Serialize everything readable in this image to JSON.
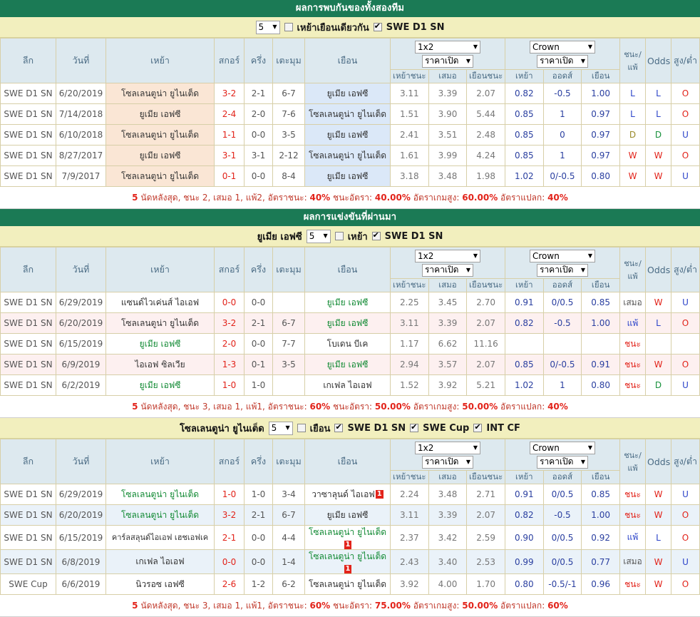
{
  "columns": {
    "league": "ลีก",
    "date": "วันที่",
    "home": "เหย้า",
    "score": "สกอร์",
    "half": "ครึ่ง",
    "corner": "เตะมุม",
    "away": "เยือน",
    "home_win": "เหย้าชนะ",
    "draw": "เสมอ",
    "away_win": "เยือนชนะ",
    "ah_home": "เหย้า",
    "ah_line": "ออดส์",
    "ah_away": "เยือน",
    "wl": "ชนะ/แพ้",
    "odds": "Odds",
    "ou": "สูง/ต่ำ",
    "odds_group_select": "1x2",
    "odds_group_sub": "ราคาเปิด",
    "ah_group_select": "Crown",
    "ah_group_sub": "ราคาเปิด"
  },
  "sections": [
    {
      "id": "h2h",
      "banner": "ผลการพบกันของทั้งสองทีม",
      "filter": {
        "team_label": "",
        "count": "5",
        "checkboxes": [
          {
            "label": "เหย้าเยือนเดียวกัน",
            "checked": false
          },
          {
            "label": "SWE D1 SN",
            "checked": true
          }
        ]
      },
      "rows": [
        {
          "league": "SWE D1 SN",
          "date": "6/20/2019",
          "home": "โซลเลนตูน่า ยูไนเต็ด",
          "home_hl": false,
          "home_badge": "",
          "score": "3-2",
          "half": "2-1",
          "corner": "6-7",
          "away": "ยูเมีย เอฟซี",
          "away_hl": true,
          "away_badge": "",
          "hw": "3.11",
          "d": "3.39",
          "aw": "2.07",
          "ahh": "0.82",
          "ahl": "-0.5",
          "aha": "1.00",
          "wl": "L",
          "wl_color": "blue",
          "odds": "L",
          "odds_color": "blue",
          "ou": "O",
          "ou_color": "red"
        },
        {
          "league": "SWE D1 SN",
          "date": "7/14/2018",
          "home": "ยูเมีย เอฟซี",
          "home_hl": true,
          "home_badge": "",
          "score": "2-4",
          "half": "2-0",
          "corner": "7-6",
          "away": "โซลเลนตูน่า ยูไนเต็ด",
          "away_hl": false,
          "away_badge": "",
          "hw": "1.51",
          "d": "3.90",
          "aw": "5.44",
          "ahh": "0.85",
          "ahl": "1",
          "aha": "0.97",
          "wl": "L",
          "wl_color": "blue",
          "odds": "L",
          "odds_color": "blue",
          "ou": "O",
          "ou_color": "red"
        },
        {
          "league": "SWE D1 SN",
          "date": "6/10/2018",
          "home": "โซลเลนตูน่า ยูไนเต็ด",
          "home_hl": false,
          "home_badge": "",
          "score": "1-1",
          "half": "0-0",
          "corner": "3-5",
          "away": "ยูเมีย เอฟซี",
          "away_hl": true,
          "away_badge": "",
          "hw": "2.41",
          "d": "3.51",
          "aw": "2.48",
          "ahh": "0.85",
          "ahl": "0",
          "aha": "0.97",
          "wl": "D",
          "wl_color": "olive",
          "odds": "D",
          "odds_color": "green",
          "ou": "U",
          "ou_color": "blue"
        },
        {
          "league": "SWE D1 SN",
          "date": "8/27/2017",
          "home": "ยูเมีย เอฟซี",
          "home_hl": true,
          "home_badge": "",
          "score": "3-1",
          "half": "3-1",
          "corner": "2-12",
          "away": "โซลเลนตูน่า ยูไนเต็ด",
          "away_hl": false,
          "away_badge": "",
          "hw": "1.61",
          "d": "3.99",
          "aw": "4.24",
          "ahh": "0.85",
          "ahl": "1",
          "aha": "0.97",
          "wl": "W",
          "wl_color": "red",
          "odds": "W",
          "odds_color": "red",
          "ou": "O",
          "ou_color": "red"
        },
        {
          "league": "SWE D1 SN",
          "date": "7/9/2017",
          "home": "โซลเลนตูน่า ยูไนเต็ด",
          "home_hl": false,
          "home_badge": "",
          "score": "0-1",
          "half": "0-0",
          "corner": "8-4",
          "away": "ยูเมีย เอฟซี",
          "away_hl": true,
          "away_badge": "",
          "hw": "3.18",
          "d": "3.48",
          "aw": "1.98",
          "ahh": "1.02",
          "ahl": "0/-0.5",
          "aha": "0.80",
          "wl": "W",
          "wl_color": "red",
          "odds": "W",
          "odds_color": "red",
          "ou": "U",
          "ou_color": "blue"
        }
      ],
      "summary": {
        "count": "5",
        "text_a": "นัดหลังสุด, ชนะ 2, เสมอ 1, แพ้2, อัตราชนะ:",
        "v1": "40%",
        "text_b": "ชนะอัตรา:",
        "v2": "40.00%",
        "text_c": "อัตราเกมสูง:",
        "v3": "60.00%",
        "text_d": "อัตราแปลก:",
        "v4": "40%"
      }
    },
    {
      "id": "away-form",
      "banner": "ผลการแข่งขันที่ผ่านมา",
      "filter": {
        "team_label": "ยูเมีย เอฟซี",
        "count": "5",
        "checkboxes": [
          {
            "label": "เหย้า",
            "checked": false
          },
          {
            "label": "SWE D1 SN",
            "checked": true
          }
        ]
      },
      "rows": [
        {
          "league": "SWE D1 SN",
          "date": "6/29/2019",
          "home": "แซนด์ไวเค่นส์ ไอเอฟ",
          "home_hl": false,
          "home_badge": "",
          "score": "0-0",
          "half": "0-0",
          "corner": "",
          "away": "ยูเมีย เอฟซี",
          "away_hl": true,
          "away_badge": "",
          "hw": "2.25",
          "d": "3.45",
          "aw": "2.70",
          "ahh": "0.91",
          "ahl": "0/0.5",
          "aha": "0.85",
          "wl": "เสมอ",
          "wl_color": "dark",
          "odds": "W",
          "odds_color": "red",
          "ou": "U",
          "ou_color": "blue"
        },
        {
          "league": "SWE D1 SN",
          "date": "6/20/2019",
          "home": "โซลเลนตูน่า ยูไนเต็ด",
          "home_hl": false,
          "home_badge": "",
          "score": "3-2",
          "half": "2-1",
          "corner": "6-7",
          "away": "ยูเมีย เอฟซี",
          "away_hl": true,
          "away_badge": "",
          "hw": "3.11",
          "d": "3.39",
          "aw": "2.07",
          "ahh": "0.82",
          "ahl": "-0.5",
          "aha": "1.00",
          "wl": "แพ้",
          "wl_color": "blue",
          "odds": "L",
          "odds_color": "blue",
          "ou": "O",
          "ou_color": "red"
        },
        {
          "league": "SWE D1 SN",
          "date": "6/15/2019",
          "home": "ยูเมีย เอฟซี",
          "home_hl": true,
          "home_badge": "",
          "score": "2-0",
          "half": "0-0",
          "corner": "7-7",
          "away": "โบเดน บีเค",
          "away_hl": false,
          "away_badge": "",
          "hw": "1.17",
          "d": "6.62",
          "aw": "11.16",
          "ahh": "",
          "ahl": "",
          "aha": "",
          "wl": "ชนะ",
          "wl_color": "red",
          "odds": "",
          "odds_color": "dark",
          "ou": "",
          "ou_color": "dark"
        },
        {
          "league": "SWE D1 SN",
          "date": "6/9/2019",
          "home": "ไอเอฟ ซิลเวีย",
          "home_hl": false,
          "home_badge": "",
          "score": "1-3",
          "half": "0-1",
          "corner": "3-5",
          "away": "ยูเมีย เอฟซี",
          "away_hl": true,
          "away_badge": "",
          "hw": "2.94",
          "d": "3.57",
          "aw": "2.07",
          "ahh": "0.85",
          "ahl": "0/-0.5",
          "aha": "0.91",
          "wl": "ชนะ",
          "wl_color": "red",
          "odds": "W",
          "odds_color": "red",
          "ou": "O",
          "ou_color": "red"
        },
        {
          "league": "SWE D1 SN",
          "date": "6/2/2019",
          "home": "ยูเมีย เอฟซี",
          "home_hl": true,
          "home_badge": "",
          "score": "1-0",
          "half": "1-0",
          "corner": "",
          "away": "เกเฟล ไอเอฟ",
          "away_hl": false,
          "away_badge": "",
          "hw": "1.52",
          "d": "3.92",
          "aw": "5.21",
          "ahh": "1.02",
          "ahl": "1",
          "aha": "0.80",
          "wl": "ชนะ",
          "wl_color": "red",
          "odds": "D",
          "odds_color": "green",
          "ou": "U",
          "ou_color": "blue"
        }
      ],
      "summary": {
        "count": "5",
        "text_a": "นัดหลังสุด, ชนะ 3, เสมอ 1, แพ้1, อัตราชนะ:",
        "v1": "60%",
        "text_b": "ชนะอัตรา:",
        "v2": "50.00%",
        "text_c": "อัตราเกมสูง:",
        "v3": "50.00%",
        "text_d": "อัตราแปลก:",
        "v4": "40%"
      }
    },
    {
      "id": "home-form",
      "banner": "",
      "filter": {
        "team_label": "โซลเลนตูน่า ยูไนเต็ด",
        "count": "5",
        "checkboxes": [
          {
            "label": "เยือน",
            "checked": false
          },
          {
            "label": "SWE D1 SN",
            "checked": true
          },
          {
            "label": "SWE Cup",
            "checked": true
          },
          {
            "label": "INT CF",
            "checked": true
          }
        ]
      },
      "rows": [
        {
          "league": "SWE D1 SN",
          "date": "6/29/2019",
          "home": "โซลเลนตูน่า ยูไนเต็ด",
          "home_hl": true,
          "home_badge": "",
          "score": "1-0",
          "half": "1-0",
          "corner": "3-4",
          "away": "วาซาลุนด์ ไอเอฟ",
          "away_hl": false,
          "away_badge": "1",
          "hw": "2.24",
          "d": "3.48",
          "aw": "2.71",
          "ahh": "0.91",
          "ahl": "0/0.5",
          "aha": "0.85",
          "wl": "ชนะ",
          "wl_color": "red",
          "odds": "W",
          "odds_color": "red",
          "ou": "U",
          "ou_color": "blue"
        },
        {
          "league": "SWE D1 SN",
          "date": "6/20/2019",
          "home": "โซลเลนตูน่า ยูไนเต็ด",
          "home_hl": true,
          "home_badge": "",
          "score": "3-2",
          "half": "2-1",
          "corner": "6-7",
          "away": "ยูเมีย เอฟซี",
          "away_hl": false,
          "away_badge": "",
          "hw": "3.11",
          "d": "3.39",
          "aw": "2.07",
          "ahh": "0.82",
          "ahl": "-0.5",
          "aha": "1.00",
          "wl": "ชนะ",
          "wl_color": "red",
          "odds": "W",
          "odds_color": "red",
          "ou": "O",
          "ou_color": "red"
        },
        {
          "league": "SWE D1 SN",
          "date": "6/15/2019",
          "home": "คาร์ลสลุนด์ไอเอฟ เฮชเอฟเค",
          "home_hl": false,
          "home_badge": "",
          "score": "2-1",
          "half": "0-0",
          "corner": "4-4",
          "away": "โซลเลนตูน่า ยูไนเต็ด",
          "away_hl": true,
          "away_badge": "1",
          "hw": "2.37",
          "d": "3.42",
          "aw": "2.59",
          "ahh": "0.90",
          "ahl": "0/0.5",
          "aha": "0.92",
          "wl": "แพ้",
          "wl_color": "blue",
          "odds": "L",
          "odds_color": "blue",
          "ou": "O",
          "ou_color": "red"
        },
        {
          "league": "SWE D1 SN",
          "date": "6/8/2019",
          "home": "เกเฟล ไอเอฟ",
          "home_hl": false,
          "home_badge": "",
          "score": "0-0",
          "half": "0-0",
          "corner": "1-4",
          "away": "โซลเลนตูน่า ยูไนเต็ด",
          "away_hl": true,
          "away_badge": "1",
          "hw": "2.43",
          "d": "3.40",
          "aw": "2.53",
          "ahh": "0.99",
          "ahl": "0/0.5",
          "aha": "0.77",
          "wl": "เสมอ",
          "wl_color": "dark",
          "odds": "W",
          "odds_color": "red",
          "ou": "U",
          "ou_color": "blue"
        },
        {
          "league": "SWE Cup",
          "date": "6/6/2019",
          "home": "นิวรอซ เอฟซี",
          "home_hl": false,
          "home_badge": "",
          "score": "2-6",
          "half": "1-2",
          "corner": "6-2",
          "away": "โซลเลนตูน่า ยูไนเต็ด",
          "away_hl": false,
          "away_badge": "",
          "hw": "3.92",
          "d": "4.00",
          "aw": "1.70",
          "ahh": "0.80",
          "ahl": "-0.5/-1",
          "aha": "0.96",
          "wl": "ชนะ",
          "wl_color": "red",
          "odds": "W",
          "odds_color": "red",
          "ou": "O",
          "ou_color": "red"
        }
      ],
      "summary": {
        "count": "5",
        "text_a": "นัดหลังสุด, ชนะ 3, เสมอ 1, แพ้1, อัตราชนะ:",
        "v1": "60%",
        "text_b": "ชนะอัตรา:",
        "v2": "75.00%",
        "text_c": "อัตราเกมสูง:",
        "v3": "50.00%",
        "text_d": "อัตราแปลก:",
        "v4": "60%"
      }
    }
  ],
  "colors": {
    "banner_green": "#1b7a55",
    "filter_yellow": "#f2efbe",
    "header_blue": "#dde9ef",
    "home_peach": "#fae6d5",
    "away_blue": "#dbe8f8",
    "score_red": "#e2231a",
    "team_green": "#128a34"
  }
}
